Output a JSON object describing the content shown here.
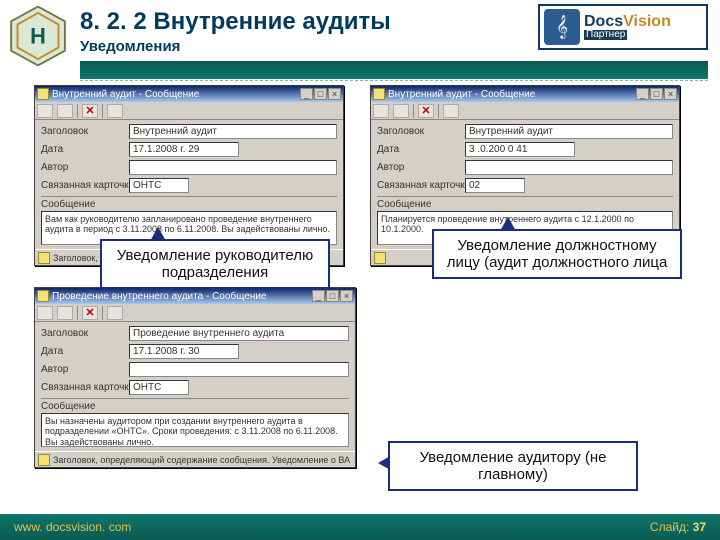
{
  "header": {
    "title": "8. 2. 2  Внутренние аудиты",
    "subtitle": "Уведомления"
  },
  "logo_partner": {
    "brand_a": "Docs",
    "brand_b": "Vision",
    "sub": "Партнер"
  },
  "windows": {
    "w1": {
      "title": "Внутренний аудит - Сообщение",
      "fields": {
        "f1_label": "Заголовок",
        "f1_val": "Внутренний аудит",
        "f2_label": "Дата",
        "f2_val": "17.1.2008  г. 29",
        "f3_label": "Автор",
        "f3_val": "",
        "f4_label": "Связанная карточка",
        "f4_val": "ОНТС"
      },
      "section": "Сообщение",
      "body": "Вам как руководителю запланировано проведение внутреннего аудита в период с 3.11.2008 по 6.11.2008. Вы задействованы лично.",
      "status": "Заголовок, определяющий содержание сообщения"
    },
    "w2": {
      "title": "Внутренний аудит - Сообщение",
      "fields": {
        "f1_label": "Заголовок",
        "f1_val": "Внутренний аудит",
        "f2_label": "Дата",
        "f2_val": "3 .0.200  0 41",
        "f3_label": "Автор",
        "f3_val": "",
        "f4_label": "Связанная карточка",
        "f4_val": "02"
      },
      "section": "Сообщение",
      "body": "Планируется проведение внутреннего аудита с 12.1.2000 по 10.1.2000.",
      "status": ""
    },
    "w3": {
      "title": "Проведение внутреннего аудита - Сообщение",
      "fields": {
        "f1_label": "Заголовок",
        "f1_val": "Проведение внутреннего аудита",
        "f2_label": "Дата",
        "f2_val": "17.1.2008  г. 30",
        "f3_label": "Автор",
        "f3_val": "",
        "f4_label": "Связанная карточка",
        "f4_val": "ОНТС"
      },
      "section": "Сообщение",
      "body": "Вы назначены аудитором при создании внутреннего аудита в подразделении «ОНТС». Сроки проведения: с 3.11.2008 по 6.11.2008. Вы задействованы лично.",
      "status": "Заголовок, определяющий содержание сообщения. Уведомление о ВА"
    }
  },
  "callouts": {
    "c1": "Уведомление руководителю подразделения",
    "c2": "Уведомление должностному лицу (аудит должностного лица",
    "c3": "Уведомление аудитору (не главному)"
  },
  "footer": {
    "left": "www. docsvision. com",
    "right_label": "Слайд:",
    "right_num": "37"
  }
}
